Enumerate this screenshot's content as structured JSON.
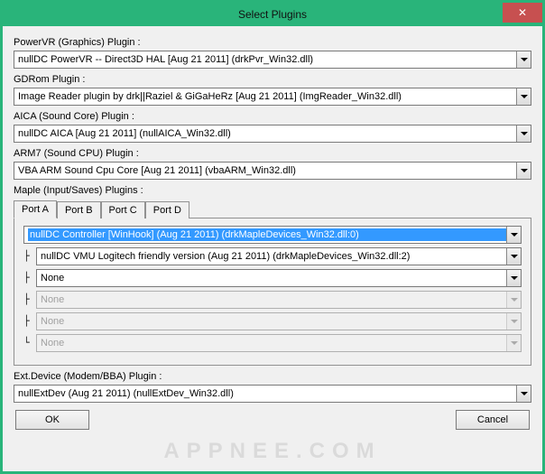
{
  "window": {
    "title": "Select Plugins"
  },
  "labels": {
    "powervr": "PowerVR (Graphics) Plugin :",
    "gdrom": "GDRom Plugin :",
    "aica": "AICA (Sound Core) Plugin :",
    "arm7": "ARM7 (Sound CPU) Plugin :",
    "maple": "Maple (Input/Saves) Plugins :",
    "extdev": "Ext.Device (Modem/BBA) Plugin :"
  },
  "combos": {
    "powervr": "nullDC PowerVR -- Direct3D HAL [Aug 21 2011] (drkPvr_Win32.dll)",
    "gdrom": "Image Reader plugin by drk||Raziel & GiGaHeRz [Aug 21 2011] (ImgReader_Win32.dll)",
    "aica": "nullDC AICA [Aug 21 2011] (nullAICA_Win32.dll)",
    "arm7": "VBA ARM Sound Cpu Core [Aug 21 2011] (vbaARM_Win32.dll)",
    "extdev": "nullExtDev (Aug 21 2011) (nullExtDev_Win32.dll)"
  },
  "tabs": [
    "Port A",
    "Port B",
    "Port C",
    "Port D"
  ],
  "maple": {
    "root": "nullDC Controller [WinHook] (Aug 21 2011) (drkMapleDevices_Win32.dll:0)",
    "sub1": "nullDC VMU Logitech friendly version (Aug 21 2011) (drkMapleDevices_Win32.dll:2)",
    "sub2": "None",
    "sub3": "None",
    "sub4": "None",
    "sub5": "None"
  },
  "buttons": {
    "ok": "OK",
    "cancel": "Cancel"
  },
  "watermark": "APPNEE.COM"
}
